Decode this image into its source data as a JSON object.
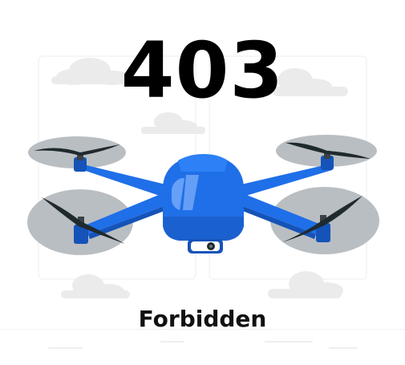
{
  "error": {
    "code": "403",
    "message": "Forbidden"
  },
  "illustration": {
    "subject": "quadcopter-drone",
    "icon": "drone-icon",
    "colors": {
      "body": "#1f6fe8",
      "body_dark": "#1553b8",
      "propeller": "#1f2a2e",
      "rotor_disc": "#b9bec2",
      "cloud": "#e8e8e8",
      "panel": "#f3f3f3"
    }
  }
}
